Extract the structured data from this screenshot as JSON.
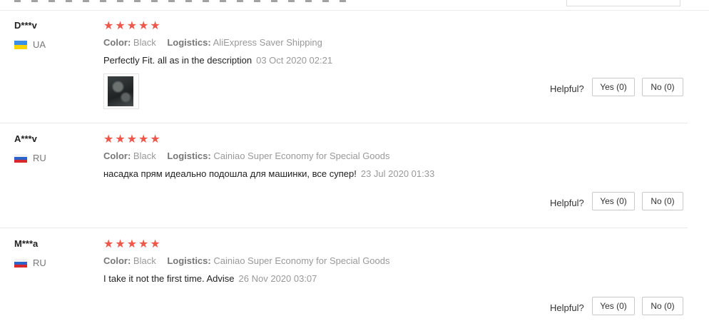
{
  "reviews": [
    {
      "user": "D***v",
      "country": "UA",
      "stars": "★★★★★",
      "color_label": "Color:",
      "color_value": "Black",
      "logistics_label": "Logistics:",
      "logistics_value": "AliExpress Saver Shipping",
      "text": "Perfectly Fit. all as in the description",
      "date": "03 Oct 2020 02:21",
      "rating": 5,
      "has_photo": true,
      "helpful_label": "Helpful?",
      "yes_label": "Yes (0)",
      "no_label": "No (0)"
    },
    {
      "user": "A***v",
      "country": "RU",
      "stars": "★★★★★",
      "color_label": "Color:",
      "color_value": "Black",
      "logistics_label": "Logistics:",
      "logistics_value": "Cainiao Super Economy for Special Goods",
      "text": "насадка прям идеально подошла для машинки, все супер!",
      "date": "23 Jul 2020 01:33",
      "rating": 5,
      "has_photo": false,
      "helpful_label": "Helpful?",
      "yes_label": "Yes (0)",
      "no_label": "No (0)"
    },
    {
      "user": "M***a",
      "country": "RU",
      "stars": "★★★★★",
      "color_label": "Color:",
      "color_value": "Black",
      "logistics_label": "Logistics:",
      "logistics_value": "Cainiao Super Economy for Special Goods",
      "text": "I take it not the first time. Advise",
      "date": "26 Nov 2020 03:07",
      "rating": 5,
      "has_photo": false,
      "helpful_label": "Helpful?",
      "yes_label": "Yes (0)",
      "no_label": "No (0)"
    }
  ],
  "colors": {
    "star": "#f0564a",
    "muted": "#999999",
    "separator": "#e8e8e8"
  }
}
